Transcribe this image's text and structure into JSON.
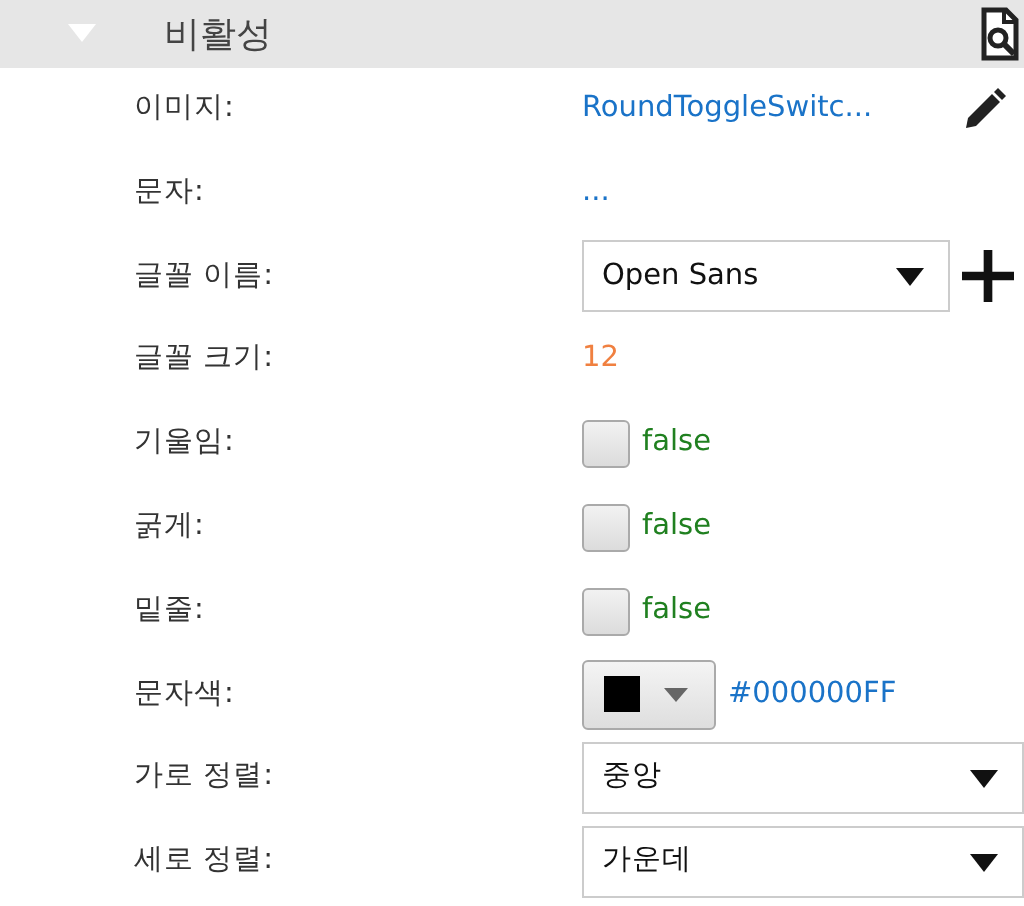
{
  "section": {
    "title": "비활성",
    "expanded": true
  },
  "properties": [
    {
      "label": "이미지:",
      "kind": "link",
      "value": "RoundToggleSwitc...",
      "editable": true
    },
    {
      "label": "문자:",
      "kind": "link",
      "value": "..."
    },
    {
      "label": "글꼴 이름:",
      "kind": "select",
      "value": "Open Sans",
      "addable": true
    },
    {
      "label": "글꼴 크기:",
      "kind": "number",
      "value": "12"
    },
    {
      "label": "기울임:",
      "kind": "checkbox",
      "checked": false,
      "value": "false"
    },
    {
      "label": "굵게:",
      "kind": "checkbox",
      "checked": false,
      "value": "false"
    },
    {
      "label": "밑줄:",
      "kind": "checkbox",
      "checked": false,
      "value": "false"
    },
    {
      "label": "문자색:",
      "kind": "color",
      "color": "#000000",
      "value": "#000000FF"
    },
    {
      "label": "가로 정렬:",
      "kind": "select",
      "value": "중앙"
    },
    {
      "label": "세로 정렬:",
      "kind": "select",
      "value": "가운데"
    }
  ]
}
